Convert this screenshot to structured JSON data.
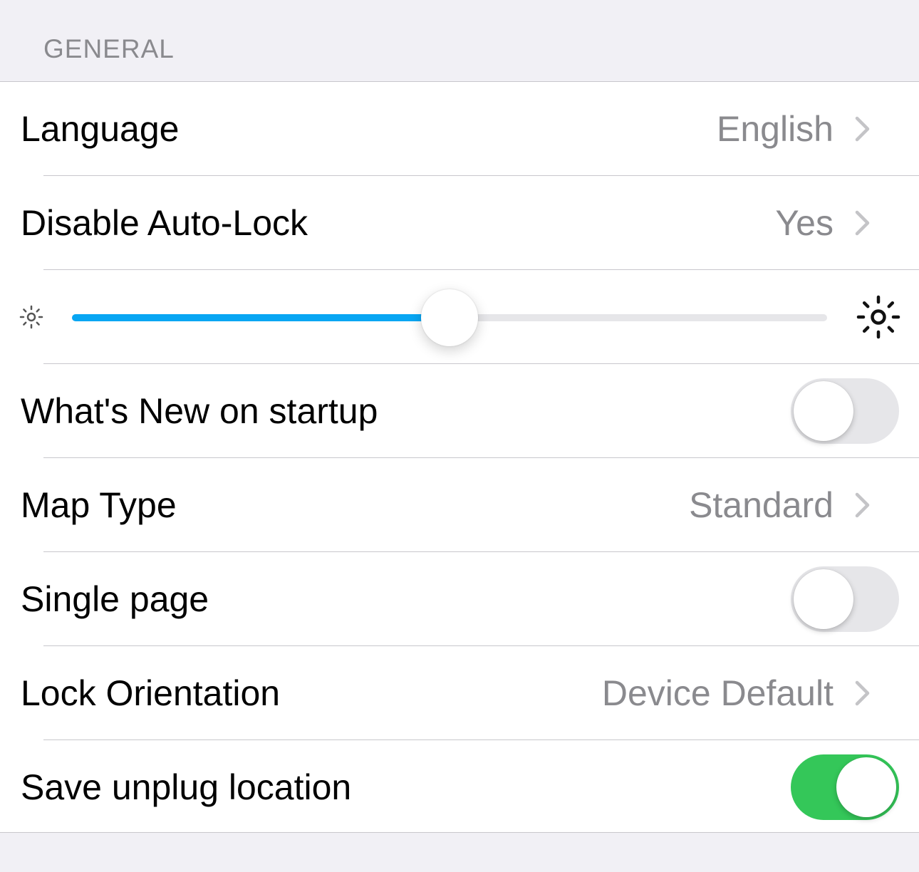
{
  "section": {
    "title": "GENERAL"
  },
  "colors": {
    "accent": "#08a6f3",
    "toggle_on": "#34c759",
    "toggle_off": "#e6e6e9",
    "secondary_text": "#8a8a8e",
    "background": "#f1f0f5"
  },
  "rows": {
    "language": {
      "label": "Language",
      "value": "English",
      "icon": "chevron-right-icon"
    },
    "auto_lock": {
      "label": "Disable Auto-Lock",
      "value": "Yes",
      "icon": "chevron-right-icon"
    },
    "brightness": {
      "icon_min": "sun-small-icon",
      "icon_max": "sun-large-icon",
      "value_percent": 50
    },
    "whats_new": {
      "label": "What's New on startup",
      "toggle_on": false
    },
    "map_type": {
      "label": "Map Type",
      "value": "Standard",
      "icon": "chevron-right-icon"
    },
    "single_page": {
      "label": "Single page",
      "toggle_on": false
    },
    "lock_orientation": {
      "label": "Lock Orientation",
      "value": "Device Default",
      "icon": "chevron-right-icon"
    },
    "save_unplug": {
      "label": "Save unplug location",
      "toggle_on": true
    }
  }
}
